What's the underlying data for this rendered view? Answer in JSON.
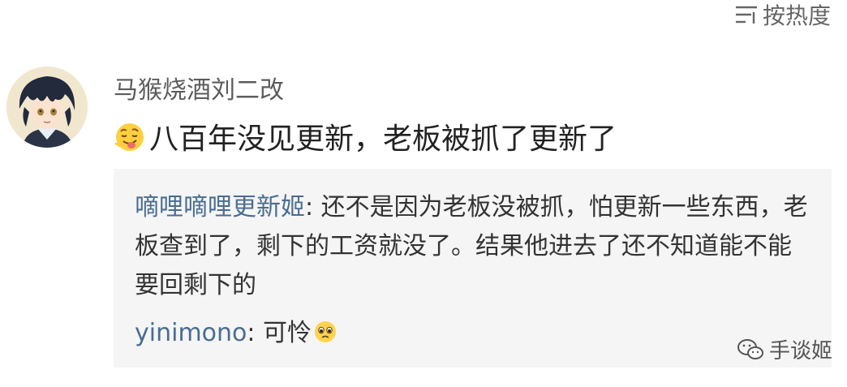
{
  "sort": {
    "icon": "sort-lines-icon",
    "label": "按热度"
  },
  "comment": {
    "avatar_icon": "anime-character-avatar",
    "username": "马猴烧酒刘二改",
    "emoji_icon": "tongue-out-emoji-icon",
    "text": "八百年没见更新，老板被抓了更新了"
  },
  "replies": [
    {
      "author": "嘀哩嘀哩更新姬",
      "separator": ": ",
      "text": "还不是因为老板没被抓，怕更新一些东西，老板查到了，剩下的工资就没了。结果他进去了还不知道能不能要回剩下的"
    },
    {
      "author": "yinimono",
      "separator": ": ",
      "text": "可怜",
      "emoji_icon": "pitiful-face-emoji-icon"
    }
  ],
  "watermark": {
    "icon": "wechat-icon",
    "text": "手谈姬"
  },
  "colors": {
    "reply_author": "#4a6d90",
    "reply_bg": "#f5f5f5",
    "text_main": "#222222"
  }
}
